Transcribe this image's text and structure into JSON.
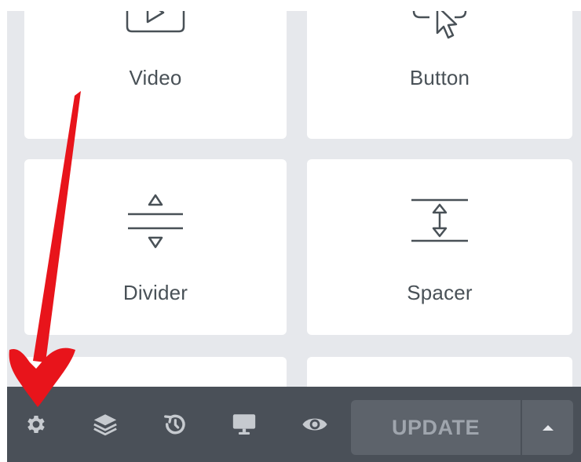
{
  "widgets": [
    {
      "label": "Video",
      "icon": "video-icon"
    },
    {
      "label": "Button",
      "icon": "button-icon"
    },
    {
      "label": "Divider",
      "icon": "divider-icon"
    },
    {
      "label": "Spacer",
      "icon": "spacer-icon"
    }
  ],
  "toolbar": {
    "items": [
      "gear-icon",
      "layers-icon",
      "history-icon",
      "monitor-icon",
      "eye-icon"
    ],
    "update_label": "UPDATE",
    "dropdown_icon": "caret-up-icon"
  },
  "colors": {
    "panel_bg": "#e6e8ec",
    "card_bg": "#ffffff",
    "label_text": "#495157",
    "toolbar_bg": "#4a5058",
    "toolbar_icon": "#c6cacf",
    "update_bg": "#5d636b",
    "update_text": "#9fa5ad",
    "annotation_arrow": "#e8141b"
  }
}
